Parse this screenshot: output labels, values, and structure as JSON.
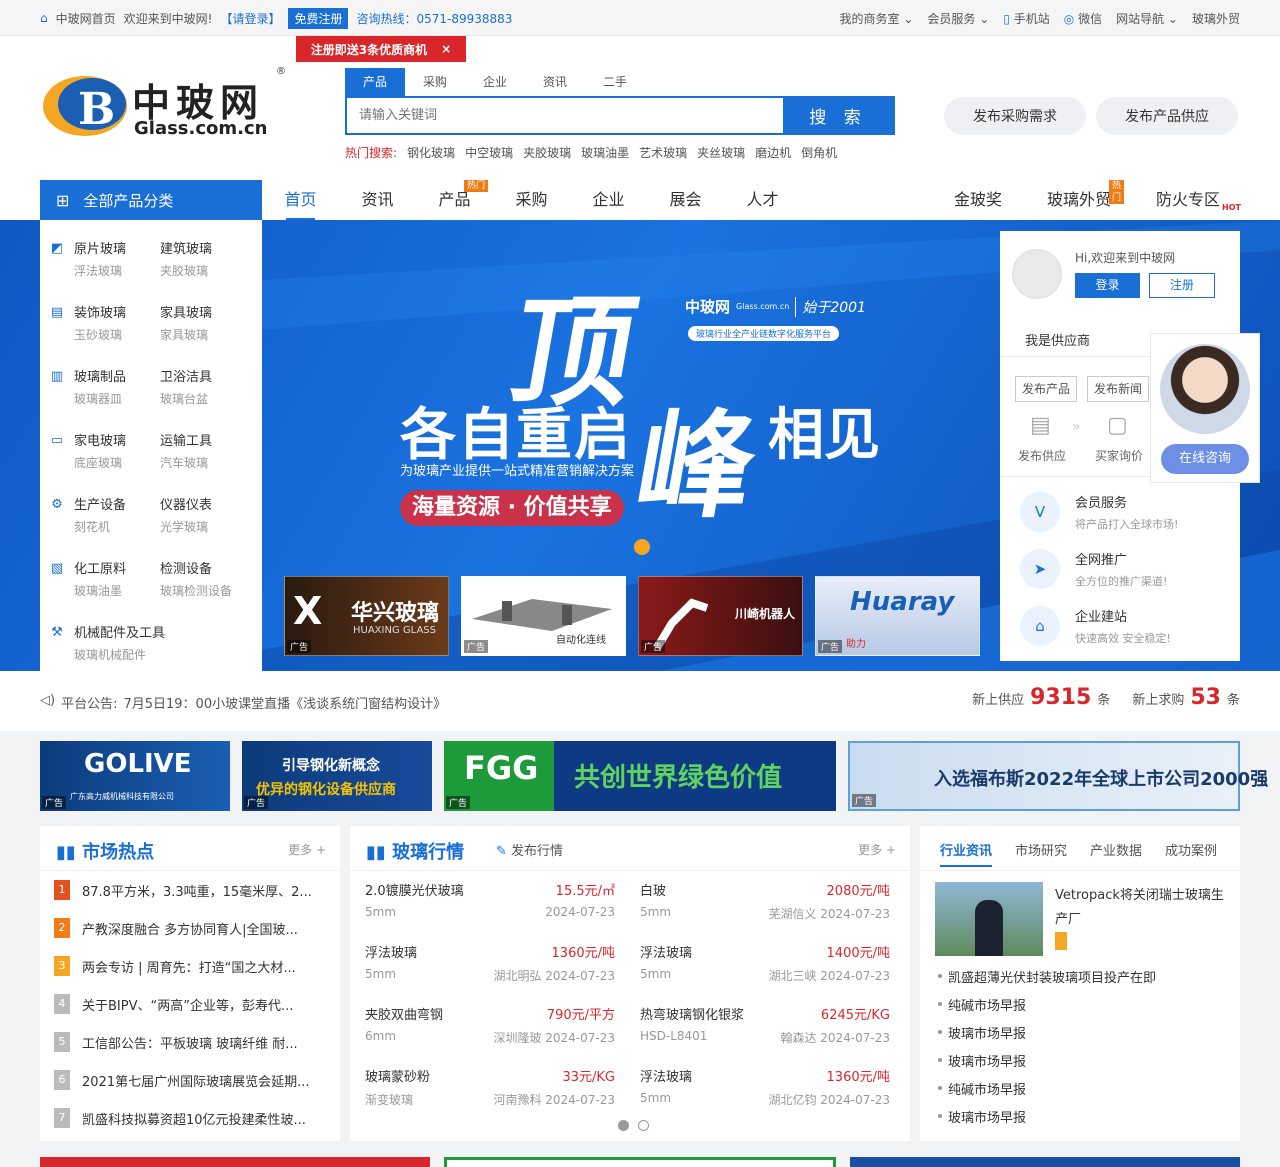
{
  "topbar": {
    "home": "中玻网首页",
    "welcome": "欢迎来到中玻网!",
    "login": "【请登录】",
    "register": "免费注册",
    "hotline": "咨询热线：0571-89938883",
    "right_links": [
      "我的商务室",
      "会员服务",
      "手机站",
      "微信",
      "网站导航",
      "玻璃外贸"
    ],
    "promo": "注册即送3条优质商机"
  },
  "logo": {
    "cn": "中玻网",
    "en": "Glass.com.cn"
  },
  "search": {
    "tabs": [
      "产品",
      "采购",
      "企业",
      "资讯",
      "二手"
    ],
    "placeholder": "请输入关键词",
    "button": "搜 索",
    "hot_label": "热门搜索:",
    "hot": [
      "钢化玻璃",
      "中空玻璃",
      "夹胶玻璃",
      "玻璃油墨",
      "艺术玻璃",
      "夹丝玻璃",
      "磨边机",
      "倒角机"
    ]
  },
  "header_buttons": [
    "发布采购需求",
    "发布产品供应"
  ],
  "nav": {
    "all_categories": "全部产品分类",
    "items": [
      "首页",
      "资讯",
      "产品",
      "采购",
      "企业",
      "展会",
      "人才"
    ],
    "right": [
      "金玻奖",
      "玻璃外贸",
      "防火专区"
    ],
    "tag_hot": "热门",
    "tag_hot_en": "HOT"
  },
  "categories": [
    {
      "a": "原片玻璃",
      "b": "建筑玻璃",
      "a2": "浮法玻璃",
      "b2": "夹胶玻璃"
    },
    {
      "a": "装饰玻璃",
      "b": "家具玻璃",
      "a2": "玉砂玻璃",
      "b2": "家具玻璃"
    },
    {
      "a": "玻璃制品",
      "b": "卫浴洁具",
      "a2": "玻璃器皿",
      "b2": "玻璃台盆"
    },
    {
      "a": "家电玻璃",
      "b": "运输工具",
      "a2": "底座玻璃",
      "b2": "汽车玻璃"
    },
    {
      "a": "生产设备",
      "b": "仪器仪表",
      "a2": "刻花机",
      "b2": "光学玻璃"
    },
    {
      "a": "化工原料",
      "b": "检测设备",
      "a2": "玻璃油墨",
      "b2": "玻璃检测设备"
    },
    {
      "a": "机械配件及工具",
      "b": "",
      "a2": "玻璃机械配件",
      "b2": ""
    }
  ],
  "banner": {
    "brand": "中玻网",
    "brand_en": "Glass.com.cn",
    "since": "始于2001",
    "platform": "玻璃行业全产业链数字化服务平台",
    "big1": "顶",
    "big2": "峰",
    "line1": "各自重启",
    "line2": "相见",
    "sub": "为玻璃产业提供一站式精准营销解决方案",
    "slogan": "海量资源 · 价值共享",
    "ads": [
      "华兴玻璃",
      "自动化连线",
      "川崎机器人",
      "Huaray"
    ],
    "ads_sub": [
      "HUAXING GLASS",
      "",
      "",
      "助力"
    ],
    "ad_label": "广告"
  },
  "user": {
    "greeting": "Hi,欢迎来到中玻网",
    "login": "登录",
    "register": "注册",
    "tab": "我是供应商",
    "btns": [
      "发布产品",
      "发布新闻"
    ],
    "flow": [
      "发布供应",
      "买家询价"
    ],
    "services": [
      {
        "t": "会员服务",
        "d": "将产品打入全球市场!"
      },
      {
        "t": "全网推广",
        "d": "全方位的推广渠道!"
      },
      {
        "t": "企业建站",
        "d": "快速高效 安全稳定!"
      }
    ],
    "consult": "在线咨询"
  },
  "announce": {
    "label": "平台公告:",
    "text": "7月5日19：00小玻课堂直播《浅谈系统门窗结构设计》",
    "supply_label": "新上供应",
    "supply": "9315",
    "purchase_label": "新上求购",
    "purchase": "53",
    "unit": "条"
  },
  "ads_strip": [
    {
      "title": "GOLIVE",
      "sub": "广东高力威机械科技有限公司"
    },
    {
      "title": "引导钢化新概念",
      "sub": "优异的钢化设备供应商"
    },
    {
      "title": "FGG",
      "sub": "共创世界绿色价值"
    },
    {
      "title": "",
      "sub": "入选福布斯2022年全球上市公司2000强"
    }
  ],
  "market_hot": {
    "title": "市场热点",
    "more": "更多 +",
    "items": [
      "87.8平方米，3.3吨重，15毫米厚、2...",
      "产教深度融合 多方协同育人|全国玻...",
      "两会专访 | 周育先：打造“国之大材...",
      "关于BIPV、“两高”企业等，彭寿代...",
      "工信部公告：平板玻璃 玻璃纤维 耐...",
      "2021第七届广州国际玻璃展览会延期...",
      "凯盛科技拟募资超10亿元投建柔性玻..."
    ],
    "num_colors": [
      "#e2511e",
      "#f07c17",
      "#f5a623",
      "#bbbbbb",
      "#bbbbbb",
      "#bbbbbb",
      "#bbbbbb"
    ]
  },
  "price": {
    "title": "玻璃行情",
    "publish": "发布行情",
    "more": "更多 +",
    "items": [
      {
        "n": "2.0镀膜光伏玻璃",
        "p": "15.5元/㎡",
        "s": "5mm",
        "m": "2024-07-23"
      },
      {
        "n": "白玻",
        "p": "2080元/吨",
        "s": "5mm",
        "m": "芜湖信义 2024-07-23"
      },
      {
        "n": "浮法玻璃",
        "p": "1360元/吨",
        "s": "5mm",
        "m": "湖北明弘 2024-07-23"
      },
      {
        "n": "浮法玻璃",
        "p": "1400元/吨",
        "s": "5mm",
        "m": "湖北三峡 2024-07-23"
      },
      {
        "n": "夹胶双曲弯钢",
        "p": "790元/平方",
        "s": "6mm",
        "m": "深圳隆玻 2024-07-23"
      },
      {
        "n": "热弯玻璃钢化银浆",
        "p": "6245元/KG",
        "s": "HSD-L8401",
        "m": "翰森达 2024-07-23"
      },
      {
        "n": "玻璃蒙砂粉",
        "p": "33元/KG",
        "s": "渐变玻璃",
        "m": "河南豫科 2024-07-23"
      },
      {
        "n": "浮法玻璃",
        "p": "1360元/吨",
        "s": "5mm",
        "m": "湖北亿钧 2024-07-23"
      }
    ]
  },
  "news": {
    "tabs": [
      "行业资讯",
      "市场研究",
      "产业数据",
      "成功案例"
    ],
    "feature": "Vetropack将关闭瑞士玻璃生产厂",
    "items": [
      "凯盛超薄光伏封装玻璃项目投产在即",
      "纯碱市场早报",
      "玻璃市场早报",
      "玻璃市场早报",
      "纯碱市场早报",
      "玻璃市场早报"
    ]
  },
  "colors": {
    "blue": "#1a6fd6",
    "red": "#d9262b",
    "orange": "#f07c17"
  }
}
